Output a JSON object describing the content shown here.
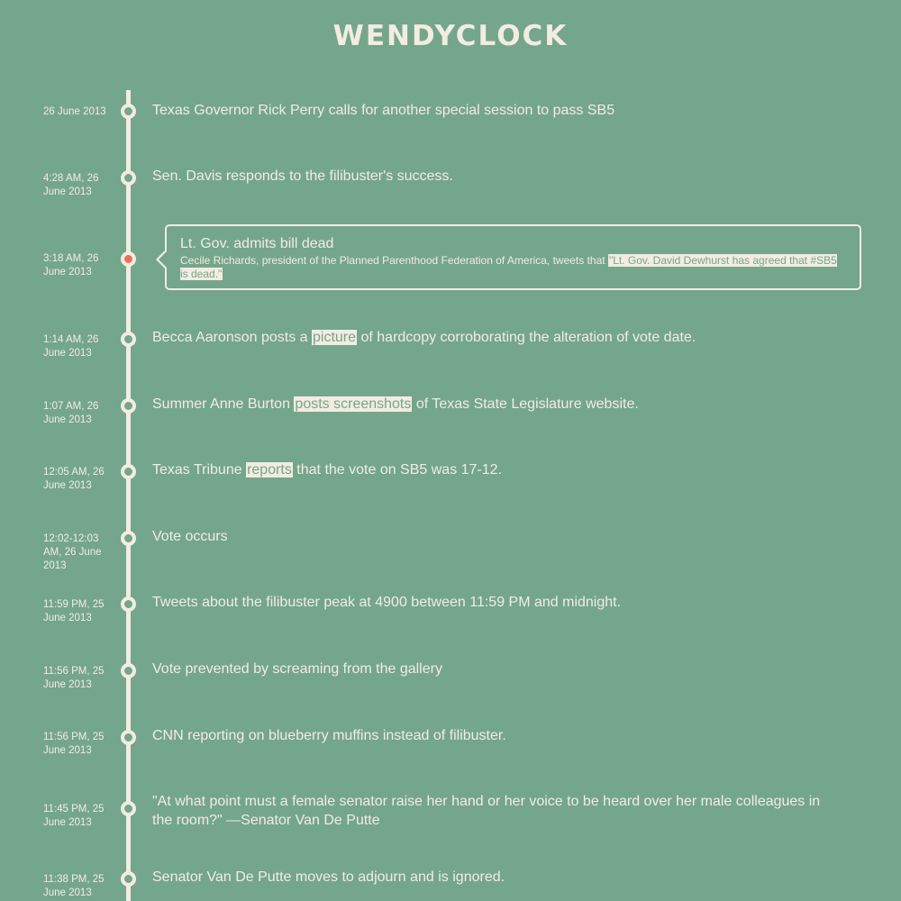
{
  "header": {
    "title": "WENDYCLOCK"
  },
  "colors": {
    "background": "#74a68b",
    "foreground": "#f3ece0",
    "active_dot": "#e8705c"
  },
  "timeline": [
    {
      "date": "26 June 2013",
      "text": "Texas Governor Rick Perry calls for another special session to pass SB5"
    },
    {
      "date": "4:28 AM, 26 June 2013",
      "text": "Sen. Davis responds to the filibuster's success."
    },
    {
      "date": "3:18 AM, 26 June 2013",
      "title": "Lt. Gov. admits bill dead",
      "body_pre": "Cecile Richards, president of the Planned Parenthood Federation of America, tweets that ",
      "body_link": "\"Lt. Gov. David Dewhurst has agreed that #SB5 is dead.\"",
      "active": true
    },
    {
      "date": "1:14 AM, 26 June 2013",
      "pre": "Becca Aaronson posts a ",
      "link": "picture",
      "post": " of hardcopy corroborating the alteration of vote date."
    },
    {
      "date": "1:07 AM, 26 June 2013",
      "pre": "Summer Anne Burton ",
      "link": "posts screenshots",
      "post": " of Texas State Legislature website."
    },
    {
      "date": "12:05 AM, 26 June 2013",
      "pre": "Texas Tribune ",
      "link": "reports",
      "post": " that the vote on SB5 was 17-12."
    },
    {
      "date": "12:02-12:03 AM, 26 June 2013",
      "text": "Vote occurs"
    },
    {
      "date": "11:59 PM, 25 June 2013",
      "text": "Tweets about the filibuster peak at 4900 between 11:59 PM and midnight."
    },
    {
      "date": "11:56 PM, 25 June 2013",
      "text": "Vote prevented by screaming from the gallery"
    },
    {
      "date": "11:56 PM, 25 June 2013",
      "text": "CNN reporting on blueberry muffins instead of filibuster."
    },
    {
      "date": "11:45 PM, 25 June 2013",
      "text": "\"At what point must a female senator raise her hand or her voice to be heard over her male colleagues in the room?\" —Senator Van De Putte"
    },
    {
      "date": "11:38 PM, 25 June 2013",
      "text": "Senator Van De Putte moves to adjourn and is ignored."
    }
  ]
}
